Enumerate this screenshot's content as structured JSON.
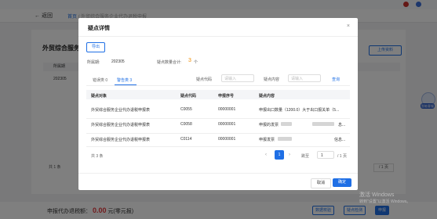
{
  "background": {
    "back_label": "← 返回",
    "breadcrumb_home": "首页",
    "breadcrumb_page": "外贸综合服务企业代办退税申报",
    "page_title": "外贸综合服务",
    "upload_button": "上传资料",
    "table_header_col": "所属期",
    "table_row_value": "202305",
    "total_text": "共 1 条",
    "page_total": "/ 1 页",
    "footer_label": "申报代办退税额：",
    "footer_amount": "0.00",
    "footer_unit": "元(零元报)",
    "footer_buttons": [
      "数据校验",
      "疑点检测",
      "申报"
    ],
    "watermark_line1": "激活 Windows",
    "watermark_line2": "转到\"设置\"以激活 Windows。",
    "assistant_badge": "智能客服"
  },
  "modal": {
    "title": "疑点详情",
    "close_icon": "×",
    "export_label": "导出",
    "period_label": "所属期:",
    "period_value": "202305",
    "count_label": "疑点数量合计:",
    "count_value": "3",
    "count_unit": "个",
    "tabs": [
      {
        "label": "错误类 0",
        "active": false
      },
      {
        "label": "警告类 3",
        "active": true
      }
    ],
    "filters": {
      "code_label": "疑点代码",
      "code_placeholder": "请输入",
      "content_label": "疑点内容",
      "content_placeholder": "请输入",
      "query_label": "查询"
    },
    "columns": [
      "疑点对象",
      "疑点代码",
      "申报序号",
      "疑点内容"
    ],
    "rows": [
      {
        "object": "外贸综合服务企业代办退税申报表",
        "code": "C0055",
        "seq": "00000001",
        "content": "申报出口数量（1200.0）大于出口报关单（5..."
      },
      {
        "object": "外贸综合服务企业代办退税申报表",
        "code": "C0058",
        "seq": "00000001",
        "content": "申报的发票",
        "content_tail": "息..."
      },
      {
        "object": "外贸综合服务企业代办退税申报表",
        "code": "C0114",
        "seq": "00000001",
        "content": "申报发票",
        "content_tail": "信息..."
      }
    ],
    "pagination": {
      "total_text": "共 3 条",
      "prev_icon": "‹",
      "current_page": "1",
      "next_icon": "›",
      "goto_label": "跳至",
      "goto_value": "1",
      "page_total": "/ 1 页"
    },
    "cancel_label": "取消",
    "ok_label": "确定"
  },
  "colors": {
    "accent": "#1f6fe5",
    "count_highlight": "#f08c00",
    "amount_red": "#e4393c"
  }
}
